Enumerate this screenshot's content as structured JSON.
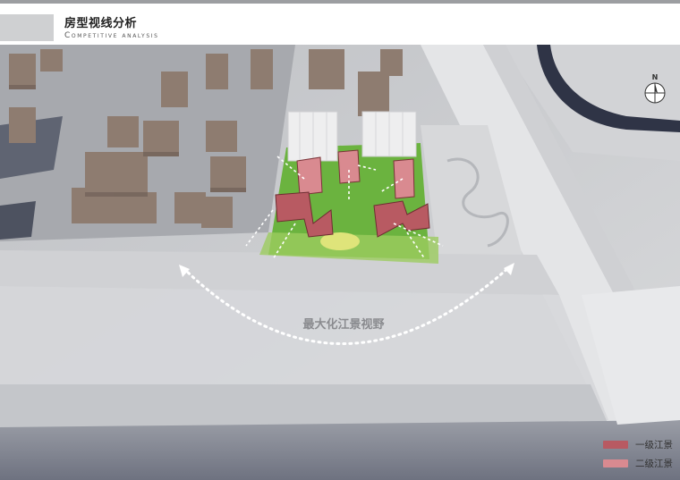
{
  "header": {
    "title": "房型视线分析",
    "subtitle": "Competitive analysis"
  },
  "annotation": {
    "view_label": "最大化江景视野"
  },
  "compass": {
    "north_letter": "N"
  },
  "legend": {
    "items": [
      {
        "label": "一级江景",
        "color": "#b85a62"
      },
      {
        "label": "二级江景",
        "color": "#d98a90"
      }
    ]
  },
  "colors": {
    "accent_primary": "#b85a62",
    "accent_secondary": "#d98a90",
    "greenery": "#6bb33f",
    "header_block": "#cfd0d2"
  }
}
